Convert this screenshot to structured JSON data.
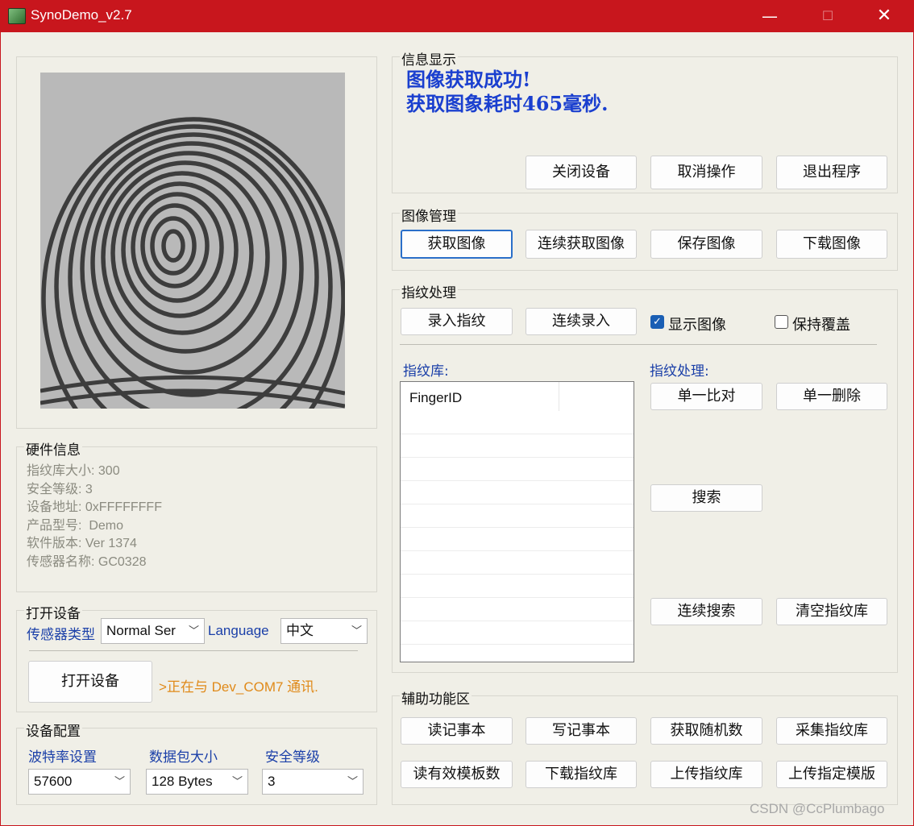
{
  "window": {
    "title": "SynoDemo_v2.7",
    "min_icon": "—",
    "max_icon": "☐",
    "close_icon": "✕"
  },
  "info": {
    "label": "信息显示",
    "line1": "图像获取成功!",
    "line2": "获取图象耗时465毫秒.",
    "buttons": [
      "关闭设备",
      "取消操作",
      "退出程序"
    ]
  },
  "image_mgmt": {
    "label": "图像管理",
    "buttons": [
      "获取图像",
      "连续获取图像",
      "保存图像",
      "下载图像"
    ]
  },
  "finger_proc": {
    "label": "指纹处理",
    "enroll": "录入指纹",
    "enroll_cont": "连续录入",
    "show_image": {
      "label": "显示图像",
      "checked": true
    },
    "keep_cover": {
      "label": "保持覆盖",
      "checked": false
    },
    "library_label": "指纹库:",
    "proc_label": "指纹处理:",
    "list_header": "FingerID",
    "match": "单一比对",
    "delete": "单一删除",
    "search": "搜索",
    "cont_search": "连续搜索",
    "clear": "清空指纹库"
  },
  "hardware": {
    "label": "硬件信息",
    "lines": [
      "指纹库大小: 300",
      "安全等级: 3",
      "设备地址: 0xFFFFFFFF",
      "产品型号:  Demo",
      "软件版本: Ver 1374",
      "传感器名称: GC0328"
    ]
  },
  "open_dev": {
    "label": "打开设备",
    "sensor_type_label": "传感器类型",
    "sensor_type_value": "Normal Ser",
    "language_label": "Language",
    "language_value": "中文",
    "open_button": "打开设备",
    "status": ">正在与 Dev_COM7 通讯."
  },
  "dev_config": {
    "label": "设备配置",
    "baud_label": "波特率设置",
    "baud_value": "57600",
    "packet_label": "数据包大小",
    "packet_value": "128 Bytes",
    "security_label": "安全等级",
    "security_value": "3"
  },
  "aux": {
    "label": "辅助功能区",
    "row1": [
      "读记事本",
      "写记事本",
      "获取随机数",
      "采集指纹库"
    ],
    "row2": [
      "读有效模板数",
      "下载指纹库",
      "上传指纹库",
      "上传指定模版"
    ]
  },
  "watermark": "CSDN @CcPlumbago",
  "colors": {
    "titlebar": "#c8161d",
    "info_text": "#1a3fcf",
    "status_text": "#e08a1a",
    "link_blue": "#1a3fa8"
  }
}
